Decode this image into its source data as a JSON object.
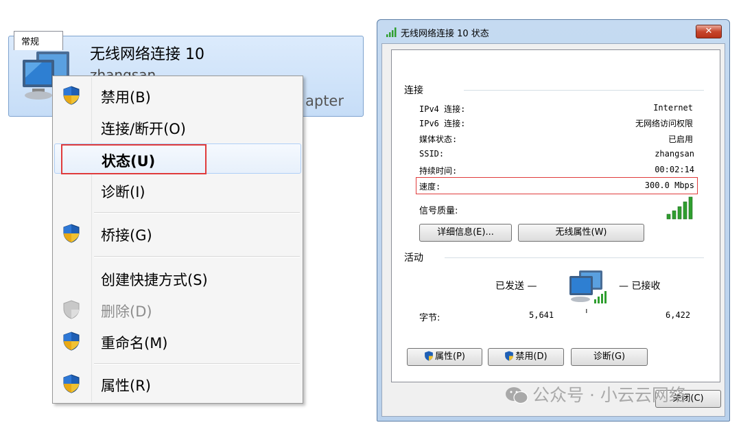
{
  "adapter": {
    "name": "无线网络连接 10",
    "subtitle": "zhangsan",
    "type_fragment": "apter"
  },
  "context_menu": {
    "items": [
      {
        "label": "禁用(B)",
        "shield": true,
        "disabled": false
      },
      {
        "label": "连接/断开(O)",
        "shield": false,
        "disabled": false
      },
      {
        "label": "状态(U)",
        "shield": false,
        "disabled": false,
        "bold": true,
        "highlighted": true
      },
      {
        "label": "诊断(I)",
        "shield": false,
        "disabled": false
      },
      {
        "label": "桥接(G)",
        "shield": true,
        "disabled": false
      },
      {
        "label": "创建快捷方式(S)",
        "shield": false,
        "disabled": false
      },
      {
        "label": "删除(D)",
        "shield": true,
        "disabled": true
      },
      {
        "label": "重命名(M)",
        "shield": true,
        "disabled": false
      },
      {
        "label": "属性(R)",
        "shield": true,
        "disabled": false
      }
    ]
  },
  "dialog": {
    "title": "无线网络连接 10 状态",
    "close_glyph": "✕",
    "tab": "常规",
    "connection": {
      "heading": "连接",
      "rows": [
        {
          "label": "IPv4 连接:",
          "value": "Internet"
        },
        {
          "label": "IPv6 连接:",
          "value": "无网络访问权限"
        },
        {
          "label": "媒体状态:",
          "value": "已启用"
        },
        {
          "label": "SSID:",
          "value": "zhangsan"
        },
        {
          "label": "持续时间:",
          "value": "00:02:14"
        },
        {
          "label": "速度:",
          "value": "300.0 Mbps"
        }
      ],
      "signal_label": "信号质量:",
      "signal_level_bars": 5,
      "details_button": "详细信息(E)...",
      "wireless_props_button": "无线属性(W)"
    },
    "activity": {
      "heading": "活动",
      "sent_label": "已发送 —",
      "received_label": "— 已接收",
      "bytes_label": "字节:",
      "bytes_sent": "5,641",
      "bytes_received": "6,422"
    },
    "buttons": {
      "properties": "属性(P)",
      "disable": "禁用(D)",
      "diagnose": "诊断(G)",
      "close": "关闭(C)"
    }
  },
  "watermark": "公众号 · 小云云网络",
  "colors": {
    "highlight_box": "#e03a3a",
    "signal_green": "#2f9e2f",
    "tile_blue": "#c6ddf7"
  }
}
